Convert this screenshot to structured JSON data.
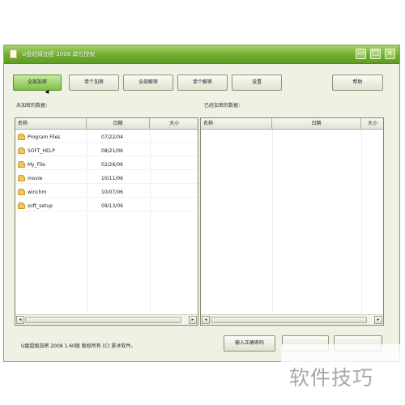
{
  "window": {
    "title": "U盘超级加密 2008 单位授权",
    "controls": {
      "restore_icon": "restore-icon",
      "close_icon": "close-icon"
    }
  },
  "toolbar": {
    "buttons": [
      {
        "label": "全部加密",
        "active": true
      },
      {
        "label": "单个加密"
      },
      {
        "label": "全部解密"
      },
      {
        "label": "单个解密"
      },
      {
        "label": "设置"
      }
    ],
    "help_label": "帮助"
  },
  "left_panel": {
    "label": "未加密的数据：",
    "columns": [
      "名称",
      "日期",
      "大小"
    ],
    "rows": [
      {
        "name": "Program Files",
        "date": "07/22/04",
        "size": ""
      },
      {
        "name": "SOFT_HELP",
        "date": "08/21/06",
        "size": ""
      },
      {
        "name": "My_File",
        "date": "02/26/06",
        "size": ""
      },
      {
        "name": "movie",
        "date": "10/11/06",
        "size": ""
      },
      {
        "name": "winchm",
        "date": "10/07/06",
        "size": ""
      },
      {
        "name": "soft_setup",
        "date": "09/13/06",
        "size": ""
      }
    ]
  },
  "right_panel": {
    "label": "已经加密的数据：",
    "columns": [
      "名称",
      "日期",
      "大小"
    ],
    "rows": []
  },
  "status": {
    "text": "U盘超级加密 2008  1.60版  版权所有 (C) 夏冰软件。"
  },
  "bottom_buttons": {
    "password_label": "输入正确密码"
  },
  "watermark": {
    "text": "软件技巧"
  },
  "colors": {
    "title_bar": "#6fae2e",
    "active_button": "#7fbd45",
    "window_bg": "#eef1e3"
  }
}
